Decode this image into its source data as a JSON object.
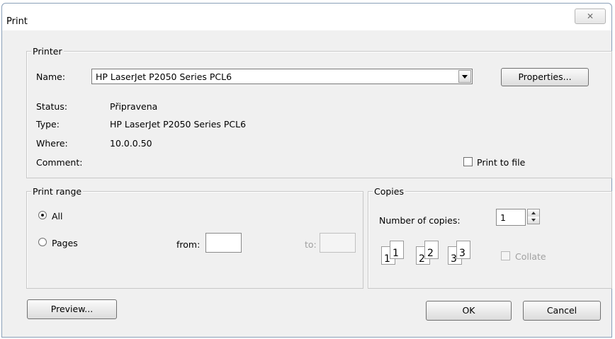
{
  "window": {
    "title": "Print"
  },
  "printer_group": {
    "legend": "Printer",
    "name_label": "Name:",
    "name_value": "HP LaserJet P2050 Series PCL6",
    "properties_button": "Properties...",
    "status_label": "Status:",
    "status_value": "Připravena",
    "type_label": "Type:",
    "type_value": "HP LaserJet P2050 Series PCL6",
    "where_label": "Where:",
    "where_value": "10.0.0.50",
    "comment_label": "Comment:",
    "print_to_file_label": "Print to file"
  },
  "print_range": {
    "legend": "Print range",
    "all_label": "All",
    "pages_label": "Pages",
    "from_label": "from:",
    "to_label": "to:",
    "from_value": "",
    "to_value": "",
    "selected": "All"
  },
  "copies": {
    "legend": "Copies",
    "number_label": "Number of copies:",
    "number_value": "1",
    "collate_label": "Collate",
    "page_icons": [
      "1",
      "2",
      "3"
    ]
  },
  "buttons": {
    "preview": "Preview...",
    "ok": "OK",
    "cancel": "Cancel"
  }
}
